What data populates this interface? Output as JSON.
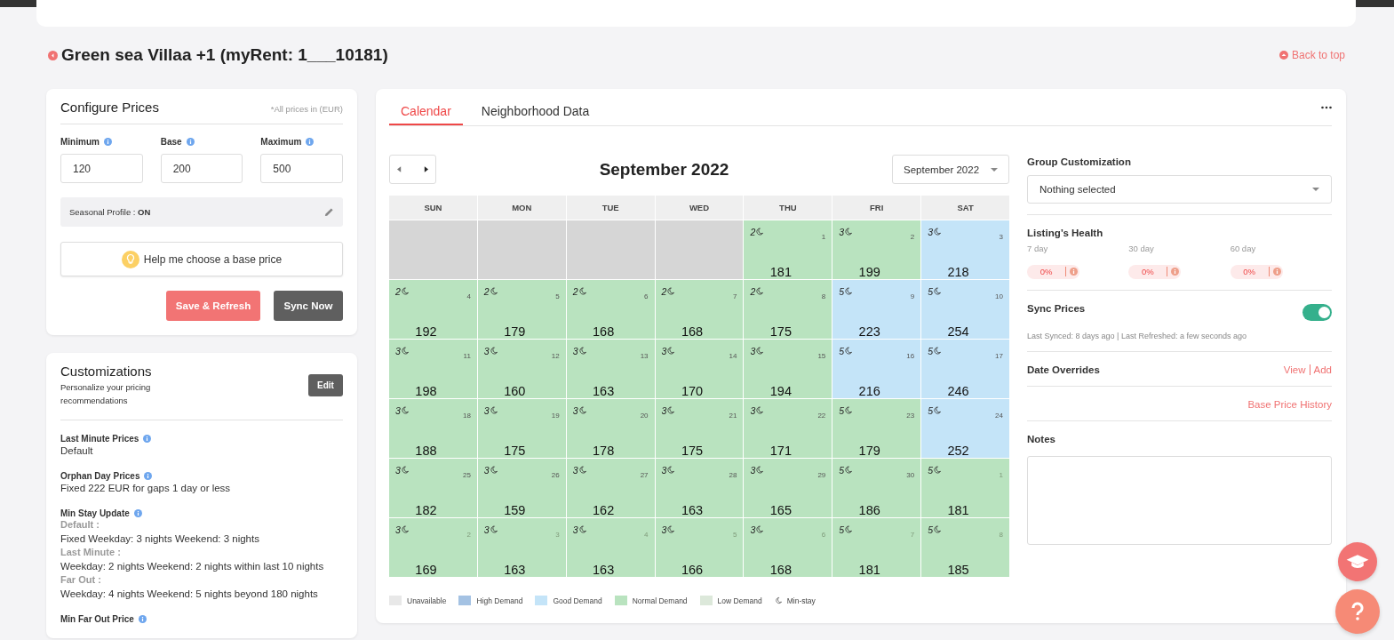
{
  "header": {
    "title": "Green sea Villaa +1 (myRent: 1___10181)",
    "back_link": "Back to top"
  },
  "configure": {
    "title": "Configure Prices",
    "note": "*All prices in (EUR)",
    "fields": [
      {
        "label": "Minimum",
        "value": "120"
      },
      {
        "label": "Base",
        "value": "200"
      },
      {
        "label": "Maximum",
        "value": "500"
      }
    ],
    "seasonal_label": "Seasonal Profile : ",
    "seasonal_value": "ON",
    "help_button": "Help me choose a base price",
    "save_button": "Save & Refresh",
    "sync_button": "Sync Now"
  },
  "customizations": {
    "title": "Customizations",
    "subtitle": "Personalize your pricing recommendations",
    "edit_button": "Edit",
    "items": [
      {
        "label": "Last Minute Prices",
        "lines": [
          {
            "kind": "text",
            "text": "Default"
          }
        ]
      },
      {
        "label": "Orphan Day Prices",
        "lines": [
          {
            "kind": "text",
            "text": "Fixed 222 EUR for gaps 1 day or less"
          }
        ]
      },
      {
        "label": "Min Stay Update",
        "lines": [
          {
            "kind": "heading",
            "text": "Default :"
          },
          {
            "kind": "text",
            "text": "Fixed Weekday: 3 nights Weekend: 3 nights"
          },
          {
            "kind": "heading",
            "text": "Last Minute :"
          },
          {
            "kind": "text",
            "text": "Weekday: 2 nights Weekend: 2 nights within last 10 nights"
          },
          {
            "kind": "heading",
            "text": "Far Out :"
          },
          {
            "kind": "text",
            "text": "Weekday: 4 nights Weekend: 5 nights beyond 180 nights"
          }
        ]
      },
      {
        "label": "Min Far Out Price"
      }
    ]
  },
  "tabs": [
    {
      "label": "Calendar",
      "selected": true
    },
    {
      "label": "Neighborhood Data",
      "selected": false
    }
  ],
  "calendar": {
    "title": "September 2022",
    "month_select": "September 2022",
    "weekdays": [
      "SUN",
      "MON",
      "TUE",
      "WED",
      "THU",
      "FRI",
      "SAT"
    ],
    "weeks": [
      [
        {
          "kind": "unavailable"
        },
        {
          "kind": "unavailable"
        },
        {
          "kind": "unavailable"
        },
        {
          "kind": "unavailable"
        },
        {
          "kind": "normal",
          "min_stay": "2",
          "day": "1",
          "price": "181",
          "outside": false
        },
        {
          "kind": "normal",
          "min_stay": "3",
          "day": "2",
          "price": "199",
          "outside": false
        },
        {
          "kind": "good",
          "min_stay": "3",
          "day": "3",
          "price": "218",
          "outside": false
        }
      ],
      [
        {
          "kind": "normal",
          "min_stay": "2",
          "day": "4",
          "price": "192",
          "outside": false
        },
        {
          "kind": "normal",
          "min_stay": "2",
          "day": "5",
          "price": "179",
          "outside": false
        },
        {
          "kind": "normal",
          "min_stay": "2",
          "day": "6",
          "price": "168",
          "outside": false
        },
        {
          "kind": "normal",
          "min_stay": "2",
          "day": "7",
          "price": "168",
          "outside": false
        },
        {
          "kind": "normal",
          "min_stay": "2",
          "day": "8",
          "price": "175",
          "outside": false
        },
        {
          "kind": "good",
          "min_stay": "5",
          "day": "9",
          "price": "223",
          "outside": false
        },
        {
          "kind": "good",
          "min_stay": "5",
          "day": "10",
          "price": "254",
          "outside": false
        }
      ],
      [
        {
          "kind": "normal",
          "min_stay": "3",
          "day": "11",
          "price": "198",
          "outside": false
        },
        {
          "kind": "normal",
          "min_stay": "3",
          "day": "12",
          "price": "160",
          "outside": false
        },
        {
          "kind": "normal",
          "min_stay": "3",
          "day": "13",
          "price": "163",
          "outside": false
        },
        {
          "kind": "normal",
          "min_stay": "3",
          "day": "14",
          "price": "170",
          "outside": false
        },
        {
          "kind": "normal",
          "min_stay": "3",
          "day": "15",
          "price": "194",
          "outside": false
        },
        {
          "kind": "good",
          "min_stay": "5",
          "day": "16",
          "price": "216",
          "outside": false
        },
        {
          "kind": "good",
          "min_stay": "5",
          "day": "17",
          "price": "246",
          "outside": false
        }
      ],
      [
        {
          "kind": "normal",
          "min_stay": "3",
          "day": "18",
          "price": "188",
          "outside": false
        },
        {
          "kind": "normal",
          "min_stay": "3",
          "day": "19",
          "price": "175",
          "outside": false
        },
        {
          "kind": "normal",
          "min_stay": "3",
          "day": "20",
          "price": "178",
          "outside": false
        },
        {
          "kind": "normal",
          "min_stay": "3",
          "day": "21",
          "price": "175",
          "outside": false
        },
        {
          "kind": "normal",
          "min_stay": "3",
          "day": "22",
          "price": "171",
          "outside": false
        },
        {
          "kind": "normal",
          "min_stay": "5",
          "day": "23",
          "price": "179",
          "outside": false
        },
        {
          "kind": "good",
          "min_stay": "5",
          "day": "24",
          "price": "252",
          "outside": false
        }
      ],
      [
        {
          "kind": "normal",
          "min_stay": "3",
          "day": "25",
          "price": "182",
          "outside": false
        },
        {
          "kind": "normal",
          "min_stay": "3",
          "day": "26",
          "price": "159",
          "outside": false
        },
        {
          "kind": "normal",
          "min_stay": "3",
          "day": "27",
          "price": "162",
          "outside": false
        },
        {
          "kind": "normal",
          "min_stay": "3",
          "day": "28",
          "price": "163",
          "outside": false
        },
        {
          "kind": "normal",
          "min_stay": "3",
          "day": "29",
          "price": "165",
          "outside": false
        },
        {
          "kind": "normal",
          "min_stay": "5",
          "day": "30",
          "price": "186",
          "outside": false
        },
        {
          "kind": "normal",
          "min_stay": "5",
          "day": "1",
          "price": "181",
          "outside": true
        }
      ],
      [
        {
          "kind": "normal",
          "min_stay": "3",
          "day": "2",
          "price": "169",
          "outside": true
        },
        {
          "kind": "normal",
          "min_stay": "3",
          "day": "3",
          "price": "163",
          "outside": true
        },
        {
          "kind": "normal",
          "min_stay": "3",
          "day": "4",
          "price": "163",
          "outside": true
        },
        {
          "kind": "normal",
          "min_stay": "3",
          "day": "5",
          "price": "166",
          "outside": true
        },
        {
          "kind": "normal",
          "min_stay": "3",
          "day": "6",
          "price": "168",
          "outside": true
        },
        {
          "kind": "normal",
          "min_stay": "5",
          "day": "7",
          "price": "181",
          "outside": true
        },
        {
          "kind": "normal",
          "min_stay": "5",
          "day": "8",
          "price": "185",
          "outside": true
        }
      ]
    ],
    "legend": [
      {
        "kind": "swatch",
        "label": "Unavailable",
        "color": "#e8e8e8"
      },
      {
        "kind": "swatch",
        "label": "High Demand",
        "color": "#a4c2e3"
      },
      {
        "kind": "swatch",
        "label": "Good Demand",
        "color": "#c4e4f8"
      },
      {
        "kind": "swatch",
        "label": "Normal Demand",
        "color": "#b9e3bf"
      },
      {
        "kind": "swatch",
        "label": "Low Demand",
        "color": "#dce8da"
      },
      {
        "kind": "moon",
        "label": "Min-stay"
      }
    ]
  },
  "side": {
    "group_label": "Group Customization",
    "group_select": "Nothing selected",
    "health_title": "Listing’s Health",
    "health": [
      {
        "period": "7 day",
        "value": "0%"
      },
      {
        "period": "30 day",
        "value": "0%"
      },
      {
        "period": "60 day",
        "value": "0%"
      }
    ],
    "sync_label": "Sync Prices",
    "sync_on": true,
    "sync_note": "Last Synced: 8 days ago | Last Refreshed: a few seconds ago",
    "overrides_label": "Date Overrides",
    "view_link": "View",
    "add_link": "Add",
    "history_link": "Base Price History",
    "notes_label": "Notes"
  }
}
